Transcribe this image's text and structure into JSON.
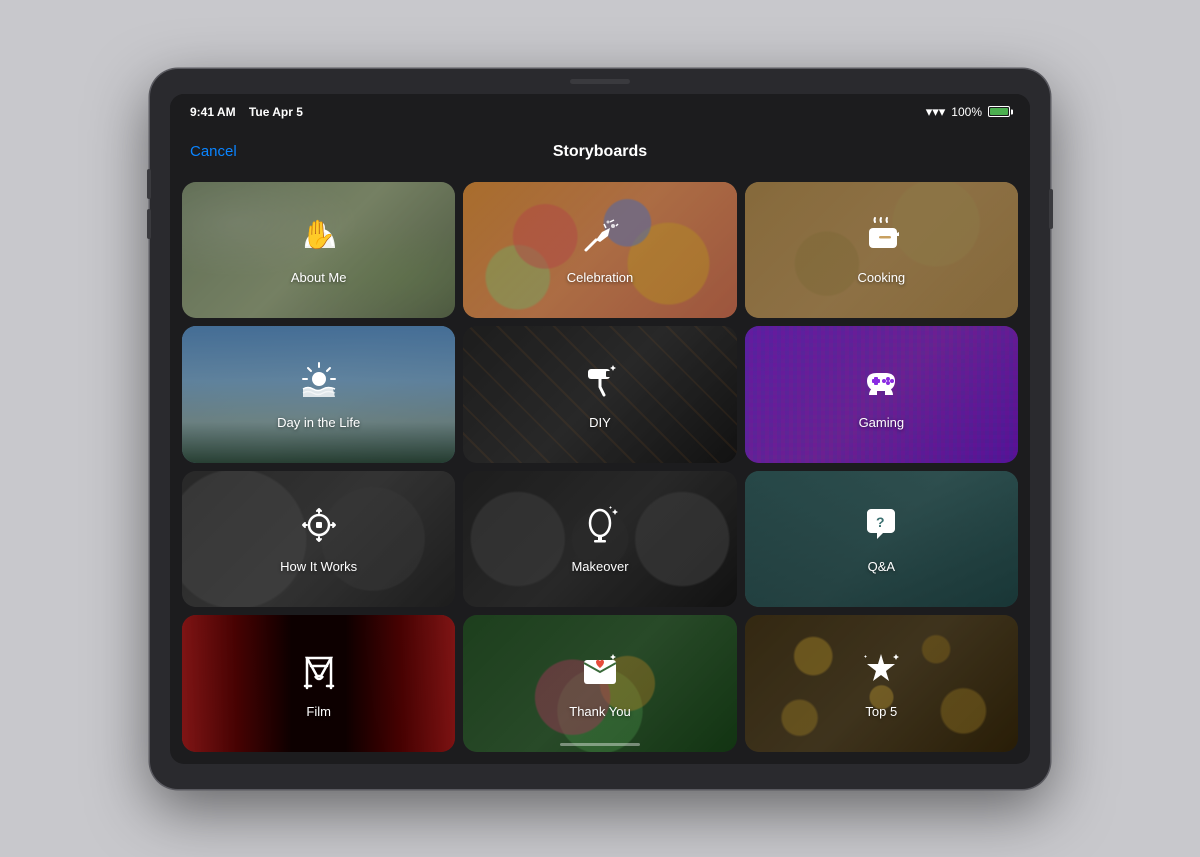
{
  "device": {
    "status_bar": {
      "time": "9:41 AM",
      "date": "Tue Apr 5",
      "wifi": "WiFi",
      "battery_percent": "100%"
    },
    "nav": {
      "cancel_label": "Cancel",
      "title": "Storyboards"
    }
  },
  "grid": {
    "items": [
      {
        "id": "about-me",
        "label": "About Me",
        "icon": "👋",
        "bg_class": "bg-about-me",
        "deco_class": "about-me-deco"
      },
      {
        "id": "celebration",
        "label": "Celebration",
        "icon": "🎉",
        "bg_class": "bg-celebration",
        "deco_class": "celebration-deco"
      },
      {
        "id": "cooking",
        "label": "Cooking",
        "icon": "🍳",
        "bg_class": "bg-cooking",
        "deco_class": "cooking-deco"
      },
      {
        "id": "day-in-life",
        "label": "Day in the Life",
        "icon": "🌅",
        "bg_class": "bg-day-in-life",
        "deco_class": "day-deco"
      },
      {
        "id": "diy",
        "label": "DIY",
        "icon": "🎨",
        "bg_class": "bg-diy",
        "deco_class": "diy-deco"
      },
      {
        "id": "gaming",
        "label": "Gaming",
        "icon": "🎮",
        "bg_class": "bg-gaming",
        "deco_class": "gaming-deco"
      },
      {
        "id": "how-it-works",
        "label": "How It Works",
        "icon": "⚙️",
        "bg_class": "bg-how-it-works",
        "deco_class": "gear-bg"
      },
      {
        "id": "makeover",
        "label": "Makeover",
        "icon": "🪞",
        "bg_class": "bg-makeover",
        "deco_class": "makeover-deco"
      },
      {
        "id": "qa",
        "label": "Q&A",
        "icon": "❓",
        "bg_class": "bg-qa",
        "deco_class": "qa-deco"
      },
      {
        "id": "film",
        "label": "Film",
        "icon": "🎬",
        "bg_class": "bg-film",
        "deco_class": "film-deco"
      },
      {
        "id": "thank-you",
        "label": "Thank You",
        "icon": "💌",
        "bg_class": "bg-thank-you",
        "deco_class": "thank-you-deco"
      },
      {
        "id": "top-5",
        "label": "Top 5",
        "icon": "⭐",
        "bg_class": "bg-top-5",
        "deco_class": "top5-deco"
      }
    ]
  },
  "icons": {
    "about_me": "✋",
    "celebration": "🎊",
    "cooking": "🍲",
    "day_in_life": "🌤",
    "diy": "🖌",
    "gaming": "🕹",
    "how_it_works": "⚙",
    "makeover": "✨",
    "qa": "💬",
    "film": "🎞",
    "thank_you": "💌",
    "top_5": "⭐"
  }
}
